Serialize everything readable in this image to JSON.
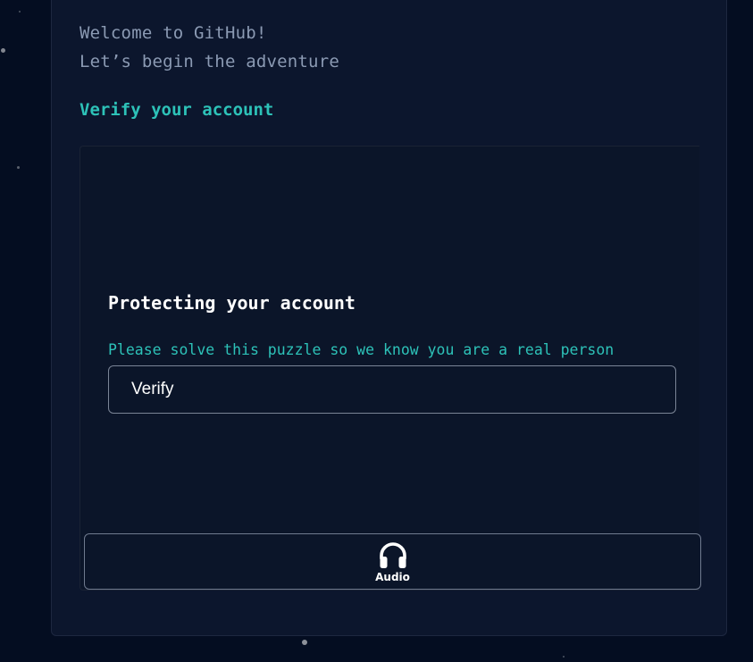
{
  "welcome": {
    "line1": "Welcome to GitHub!",
    "line2": "Let’s begin the adventure"
  },
  "verify_heading": "Verify your account",
  "puzzle": {
    "title": "Protecting your account",
    "description": "Please solve this puzzle so we know you are a real person",
    "verify_button_label": "Verify",
    "audio_button_label": "Audio",
    "audio_icon": "headphones-icon"
  },
  "colors": {
    "background": "#040d21",
    "card": "#0c162d",
    "accent": "#2dc2b8",
    "muted_text": "#8b9ab3"
  }
}
